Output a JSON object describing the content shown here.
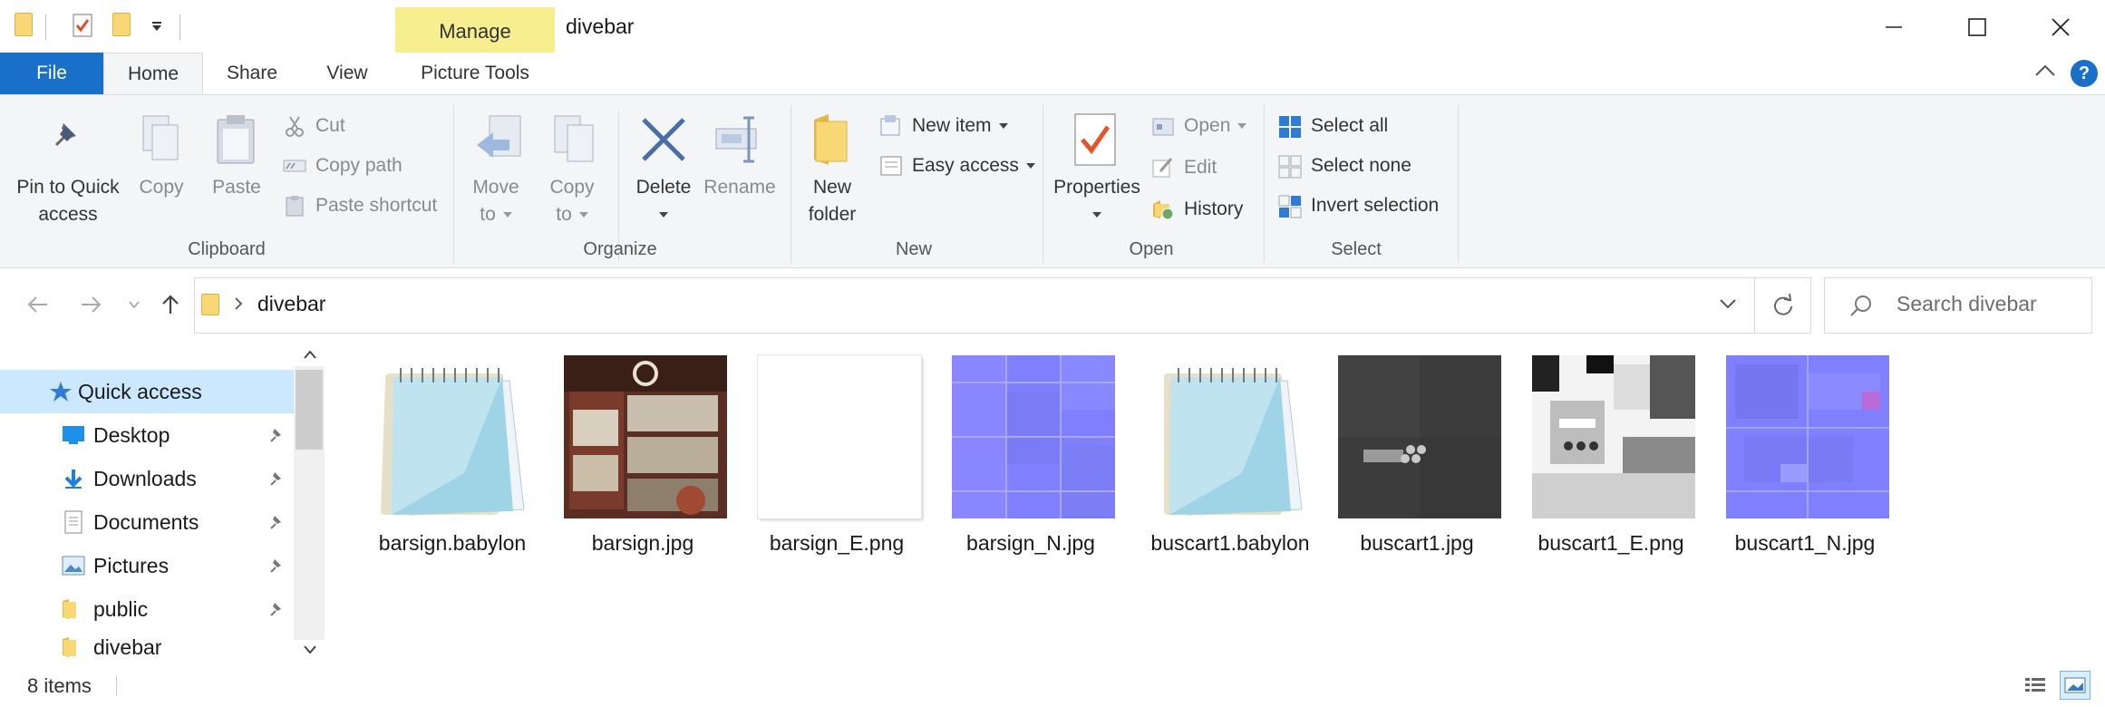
{
  "window": {
    "title": "divebar",
    "context_tab": "Manage",
    "controls": [
      "minimize",
      "maximize",
      "close"
    ]
  },
  "tabs": [
    "File",
    "Home",
    "Share",
    "View",
    "Picture Tools"
  ],
  "ribbon": {
    "clipboard": {
      "group_label": "Clipboard",
      "pin_label_1": "Pin to Quick",
      "pin_label_2": "access",
      "copy_label": "Copy",
      "paste_label": "Paste",
      "cut_label": "Cut",
      "copy_path_label": "Copy path",
      "paste_shortcut_label": "Paste shortcut"
    },
    "organize": {
      "group_label": "Organize",
      "move_to_1": "Move",
      "move_to_2": "to",
      "copy_to_1": "Copy",
      "copy_to_2": "to",
      "delete_label": "Delete",
      "rename_label": "Rename"
    },
    "new": {
      "group_label": "New",
      "new_folder_1": "New",
      "new_folder_2": "folder",
      "new_item_label": "New item",
      "easy_access_label": "Easy access"
    },
    "open": {
      "group_label": "Open",
      "properties_label": "Properties",
      "open_label": "Open",
      "edit_label": "Edit",
      "history_label": "History"
    },
    "select": {
      "group_label": "Select",
      "select_all_label": "Select all",
      "select_none_label": "Select none",
      "invert_selection_label": "Invert selection"
    }
  },
  "address": {
    "breadcrumb": "divebar",
    "search_placeholder": "Search divebar"
  },
  "nav": {
    "items": [
      {
        "label": "Quick access",
        "icon": "star-icon",
        "pinned": false
      },
      {
        "label": "Desktop",
        "icon": "desktop-icon",
        "pinned": true
      },
      {
        "label": "Downloads",
        "icon": "download-icon",
        "pinned": true
      },
      {
        "label": "Documents",
        "icon": "document-icon",
        "pinned": true
      },
      {
        "label": "Pictures",
        "icon": "pictures-icon",
        "pinned": true
      },
      {
        "label": "public",
        "icon": "folder-icon",
        "pinned": true
      },
      {
        "label": "divebar",
        "icon": "folder-icon",
        "pinned": false
      }
    ]
  },
  "files": [
    {
      "name": "barsign.babylon",
      "kind": "notepad"
    },
    {
      "name": "barsign.jpg",
      "kind": "texture-rust"
    },
    {
      "name": "barsign_E.png",
      "kind": "blank"
    },
    {
      "name": "barsign_N.jpg",
      "kind": "normal"
    },
    {
      "name": "buscart1.babylon",
      "kind": "notepad"
    },
    {
      "name": "buscart1.jpg",
      "kind": "texture-dark"
    },
    {
      "name": "buscart1_E.png",
      "kind": "texture-bw"
    },
    {
      "name": "buscart1_N.jpg",
      "kind": "normal"
    }
  ],
  "status": {
    "item_count": "8 items"
  },
  "colors": {
    "file_tab": "#1a6fc8",
    "manage_context": "#f6ee8f",
    "selection": "#cce8ff",
    "folder": "#f8d775"
  }
}
